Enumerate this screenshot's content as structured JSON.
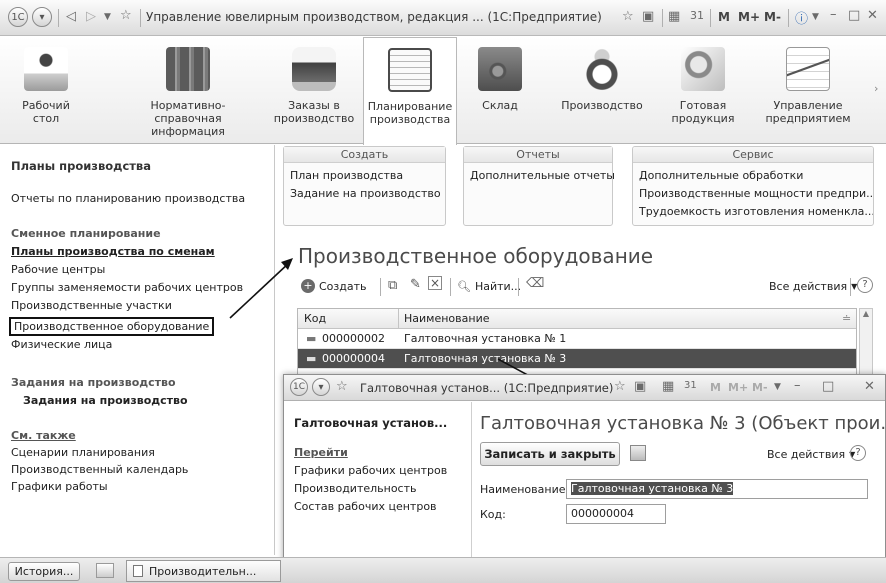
{
  "titlebar": {
    "title": "Управление ювелирным производством, редакция ... (1С:Предприятие)",
    "icons": [
      "app-menu-icon",
      "nav-icon",
      "back-icon",
      "forward-icon",
      "dropdown-icon",
      "favorite-icon",
      "favorite-add-icon",
      "history-icon",
      "calculator-icon",
      "calendar-icon",
      "info-icon",
      "minimize-icon",
      "maximize-icon",
      "close-icon"
    ],
    "m_labels": [
      "M",
      "M+",
      "M-"
    ]
  },
  "sections": [
    {
      "label": "Рабочий\nстол",
      "icon": "desk-icon"
    },
    {
      "label": "Нормативно-справочная\nинформация",
      "icon": "binders-icon"
    },
    {
      "label": "Заказы в\nпроизводство",
      "icon": "fax-icon"
    },
    {
      "label": "Планирование\nпроизводства",
      "icon": "planner-icon",
      "active": true
    },
    {
      "label": "Склад",
      "icon": "safe-icon"
    },
    {
      "label": "Производство",
      "icon": "ring-icon"
    },
    {
      "label": "Готовая\nпродукция",
      "icon": "jewel-icon"
    },
    {
      "label": "Управление\nпредприятием",
      "icon": "chart-icon"
    }
  ],
  "left": {
    "plans_head": "Планы производства",
    "reports_link": "Отчеты по планированию производства",
    "shift_group": "Сменное планирование",
    "shift_items": [
      "Планы производства по сменам",
      "Рабочие центры",
      "Группы заменяемости рабочих центров",
      "Производственные участки",
      "Производственное оборудование",
      "Физические лица"
    ],
    "tasks_group": "Задания на производство",
    "tasks_item": "Задания на производство",
    "see_also_group": "См. также",
    "see_also_items": [
      "Сценарии планирования",
      "Производственный календарь",
      "Графики работы"
    ]
  },
  "commands": {
    "create": {
      "head": "Создать",
      "items": [
        "План производства",
        "Задание на производство"
      ]
    },
    "reports": {
      "head": "Отчеты",
      "items": [
        "Дополнительные отчеты"
      ]
    },
    "service": {
      "head": "Сервис",
      "items": [
        "Дополнительные обработки",
        "Производственные мощности предпри...",
        "Трудоемкость изготовления номенкла..."
      ]
    }
  },
  "list": {
    "title": "Производственное оборудование",
    "create_label": "Создать",
    "find_label": "Найти...",
    "all_actions": "Все действия",
    "col_code": "Код",
    "col_name": "Наименование",
    "rows": [
      {
        "code": "000000002",
        "name": "Галтовочная установка № 1"
      },
      {
        "code": "000000004",
        "name": "Галтовочная установка № 3"
      }
    ]
  },
  "child": {
    "title": "Галтовочная установ... (1С:Предприятие)",
    "left_head": "Галтовочная установ...",
    "goto_label": "Перейти",
    "goto_items": [
      "Графики рабочих центров",
      "Производительность",
      "Состав рабочих центров"
    ],
    "form_title": "Галтовочная установка № 3 (Объект прои...",
    "save_close": "Записать и закрыть",
    "all_actions": "Все действия",
    "name_label": "Наименование:",
    "name_value": "Галтовочная установка № 3",
    "code_label": "Код:",
    "code_value": "000000004"
  },
  "status": {
    "history_label": "История...",
    "tab_label": "Производительн..."
  }
}
